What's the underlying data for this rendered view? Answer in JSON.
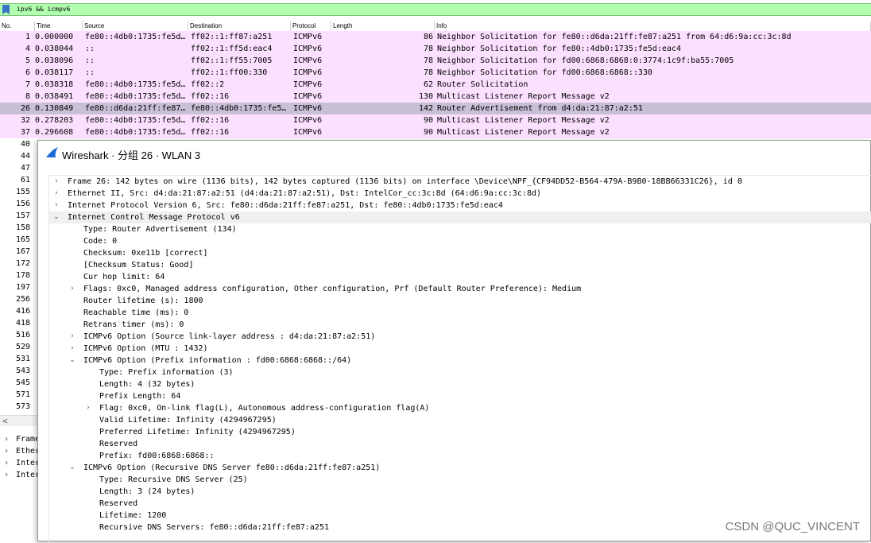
{
  "filter": {
    "value": "ipv6 && icmpv6"
  },
  "columns": {
    "no": "No.",
    "time": "Time",
    "source": "Source",
    "destination": "Destination",
    "protocol": "Protocol",
    "length": "Length",
    "info": "Info"
  },
  "packets": [
    {
      "no": "1",
      "time": "0.000000",
      "src": "fe80::4db0:1735:fe5d…",
      "dst": "ff02::1:ff87:a251",
      "proto": "ICMPv6",
      "len": "86",
      "info": "Neighbor Solicitation for fe80::d6da:21ff:fe87:a251 from 64:d6:9a:cc:3c:8d"
    },
    {
      "no": "4",
      "time": "0.038044",
      "src": "::",
      "dst": "ff02::1:ff5d:eac4",
      "proto": "ICMPv6",
      "len": "78",
      "info": "Neighbor Solicitation for fe80::4db0:1735:fe5d:eac4"
    },
    {
      "no": "5",
      "time": "0.038096",
      "src": "::",
      "dst": "ff02::1:ff55:7005",
      "proto": "ICMPv6",
      "len": "78",
      "info": "Neighbor Solicitation for fd00:6868:6868:0:3774:1c9f:ba55:7005"
    },
    {
      "no": "6",
      "time": "0.038117",
      "src": "::",
      "dst": "ff02::1:ff00:330",
      "proto": "ICMPv6",
      "len": "78",
      "info": "Neighbor Solicitation for fd00:6868:6868::330"
    },
    {
      "no": "7",
      "time": "0.038318",
      "src": "fe80::4db0:1735:fe5d…",
      "dst": "ff02::2",
      "proto": "ICMPv6",
      "len": "62",
      "info": "Router Solicitation"
    },
    {
      "no": "8",
      "time": "0.038491",
      "src": "fe80::4db0:1735:fe5d…",
      "dst": "ff02::16",
      "proto": "ICMPv6",
      "len": "130",
      "info": "Multicast Listener Report Message v2"
    },
    {
      "no": "26",
      "time": "0.130849",
      "src": "fe80::d6da:21ff:fe87…",
      "dst": "fe80::4db0:1735:fe5…",
      "proto": "ICMPv6",
      "len": "142",
      "info": "Router Advertisement from d4:da:21:87:a2:51"
    },
    {
      "no": "32",
      "time": "0.278203",
      "src": "fe80::4db0:1735:fe5d…",
      "dst": "ff02::16",
      "proto": "ICMPv6",
      "len": "90",
      "info": "Multicast Listener Report Message v2"
    },
    {
      "no": "37",
      "time": "0.296608",
      "src": "fe80::4db0:1735:fe5d…",
      "dst": "ff02::16",
      "proto": "ICMPv6",
      "len": "90",
      "info": "Multicast Listener Report Message v2"
    }
  ],
  "hidden_rows_no": [
    "40",
    "44",
    "47",
    "61",
    "155",
    "156",
    "157",
    "158",
    "165",
    "167",
    "172",
    "178",
    "197",
    "256",
    "416",
    "418",
    "516",
    "529",
    "531",
    "543",
    "545",
    "571",
    "573"
  ],
  "main_detail": [
    "Frame",
    "Ether",
    "Inter",
    "Inter"
  ],
  "window": {
    "title": "Wireshark · 分组 26 · WLAN 3"
  },
  "tree": [
    {
      "t": "Frame 26: 142 bytes on wire (1136 bits), 142 bytes captured (1136 bits) on interface \\Device\\NPF_{CF94DD52-B564-479A-B9B0-18BB66331C26}, id 0",
      "a": "right",
      "lvl": 0
    },
    {
      "t": "Ethernet II, Src: d4:da:21:87:a2:51 (d4:da:21:87:a2:51), Dst: IntelCor_cc:3c:8d (64:d6:9a:cc:3c:8d)",
      "a": "right",
      "lvl": 0
    },
    {
      "t": "Internet Protocol Version 6, Src: fe80::d6da:21ff:fe87:a251, Dst: fe80::4db0:1735:fe5d:eac4",
      "a": "right",
      "lvl": 0
    },
    {
      "t": "Internet Control Message Protocol v6",
      "a": "down",
      "lvl": 0
    },
    {
      "t": "Type: Router Advertisement (134)",
      "a": "",
      "lvl": 1
    },
    {
      "t": "Code: 0",
      "a": "",
      "lvl": 1
    },
    {
      "t": "Checksum: 0xe11b [correct]",
      "a": "",
      "lvl": 1
    },
    {
      "t": "[Checksum Status: Good]",
      "a": "",
      "lvl": 1
    },
    {
      "t": "Cur hop limit: 64",
      "a": "",
      "lvl": 1
    },
    {
      "t": "Flags: 0xc0, Managed address configuration, Other configuration, Prf (Default Router Preference): Medium",
      "a": "right",
      "lvl": 1
    },
    {
      "t": "Router lifetime (s): 1800",
      "a": "",
      "lvl": 1
    },
    {
      "t": "Reachable time (ms): 0",
      "a": "",
      "lvl": 1
    },
    {
      "t": "Retrans timer (ms): 0",
      "a": "",
      "lvl": 1
    },
    {
      "t": "ICMPv6 Option (Source link-layer address : d4:da:21:87:a2:51)",
      "a": "right",
      "lvl": 1
    },
    {
      "t": "ICMPv6 Option (MTU : 1432)",
      "a": "right",
      "lvl": 1
    },
    {
      "t": "ICMPv6 Option (Prefix information : fd00:6868:6868::/64)",
      "a": "down",
      "lvl": 1
    },
    {
      "t": "Type: Prefix information (3)",
      "a": "",
      "lvl": 2
    },
    {
      "t": "Length: 4 (32 bytes)",
      "a": "",
      "lvl": 2
    },
    {
      "t": "Prefix Length: 64",
      "a": "",
      "lvl": 2
    },
    {
      "t": "Flag: 0xc0, On-link flag(L), Autonomous address-configuration flag(A)",
      "a": "right",
      "lvl": 2
    },
    {
      "t": "Valid Lifetime: Infinity (4294967295)",
      "a": "",
      "lvl": 2
    },
    {
      "t": "Preferred Lifetime: Infinity (4294967295)",
      "a": "",
      "lvl": 2
    },
    {
      "t": "Reserved",
      "a": "",
      "lvl": 2
    },
    {
      "t": "Prefix: fd00:6868:6868::",
      "a": "",
      "lvl": 2
    },
    {
      "t": "ICMPv6 Option (Recursive DNS Server fe80::d6da:21ff:fe87:a251)",
      "a": "down",
      "lvl": 1
    },
    {
      "t": "Type: Recursive DNS Server (25)",
      "a": "",
      "lvl": 2
    },
    {
      "t": "Length: 3 (24 bytes)",
      "a": "",
      "lvl": 2
    },
    {
      "t": "Reserved",
      "a": "",
      "lvl": 2
    },
    {
      "t": "Lifetime: 1200",
      "a": "",
      "lvl": 2
    },
    {
      "t": "Recursive DNS Servers: fe80::d6da:21ff:fe87:a251",
      "a": "",
      "lvl": 2
    }
  ],
  "watermark": "CSDN @QUC_VINCENT",
  "colors": {
    "filter_bg": "#afffaf",
    "icmp_row": "#fce0ff",
    "selected_row": "#c9bfd6"
  },
  "icons": {
    "filter": "bookmark-icon",
    "window": "shark-fin-icon",
    "expand": "chevron-right-icon",
    "collapse": "chevron-down-icon",
    "scroll": "scroll-left-icon"
  }
}
